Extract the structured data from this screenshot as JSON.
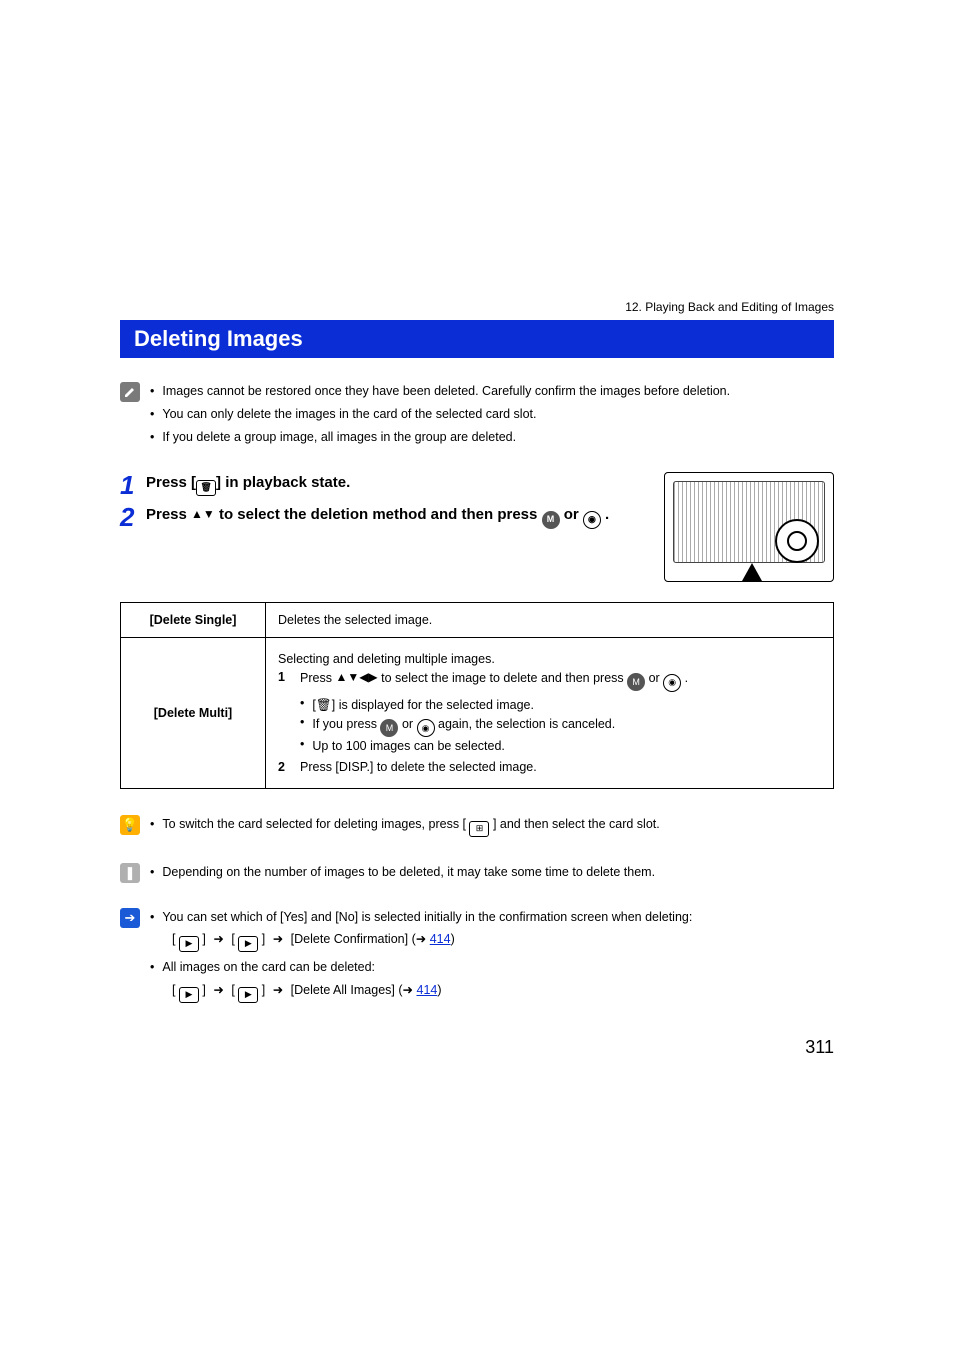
{
  "breadcrumb": "12. Playing Back and Editing of Images",
  "title": "Deleting Images",
  "intro_notes": [
    "Images cannot be restored once they have been deleted. Carefully confirm the images before deletion.",
    "You can only delete the images in the card of the selected card slot.",
    "If you delete a group image, all images in the group are deleted."
  ],
  "steps": {
    "s1": {
      "num": "1",
      "pre": "Press [",
      "post": "] in playback state."
    },
    "s2": {
      "num": "2",
      "line1_pre": "Press ",
      "line1_post": " to select the deletion method and then press ",
      "or": " or ",
      "end": " ."
    }
  },
  "table": {
    "single": {
      "label": "[Delete Single]",
      "desc": "Deletes the selected image."
    },
    "multi": {
      "label": "[Delete Multi]",
      "intro": "Selecting and deleting multiple images.",
      "sub1": {
        "n": "1",
        "a": "Press ",
        "b": " to select the image to delete and then press ",
        "or": " or ",
        "end": " ."
      },
      "b1_pre": "[",
      "b1_post": "] is displayed for the selected image.",
      "b2_pre": "If you press ",
      "b2_mid": " or ",
      "b2_post": " again, the selection is canceled.",
      "b3": "Up to 100 images can be selected.",
      "sub2": {
        "n": "2",
        "text": "Press [DISP.] to delete the selected image."
      }
    }
  },
  "tip": {
    "pre": "To switch the card selected for deleting images, press [ ",
    "post": " ] and then select the card slot."
  },
  "caution": "Depending on the number of images to be deleted, it may take some time to delete them.",
  "related": {
    "line1": "You can set which of [Yes] and [No] is selected initially in the confirmation screen when deleting:",
    "path1_label": "[Delete Confirmation]",
    "link1": "414",
    "line2": "All images on the card can be deleted:",
    "path2_label": "[Delete All Images]",
    "link2": "414"
  },
  "page_number": "311"
}
